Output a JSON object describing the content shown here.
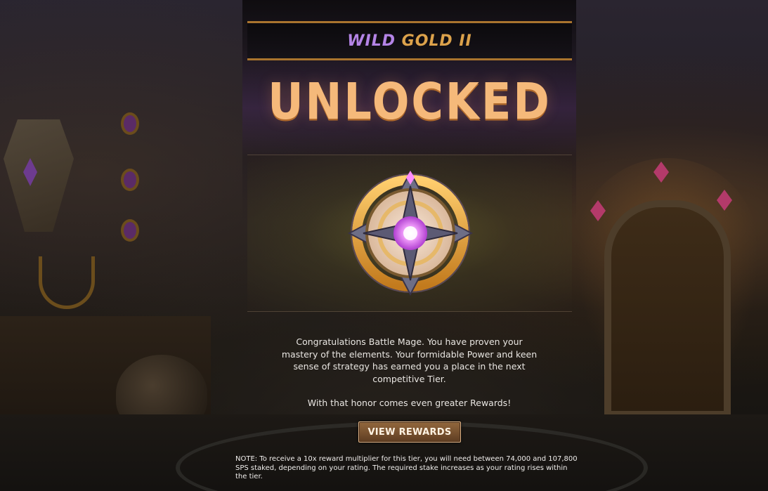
{
  "banner": {
    "tier_word_1": "WILD",
    "tier_word_2": "GOLD II"
  },
  "headline": "UNLOCKED",
  "badge": {
    "icon": "tier-badge-icon"
  },
  "message": {
    "paragraph_1": "Congratulations Battle Mage. You have proven your mastery of the elements. Your formidable Power and keen sense of strategy has earned you a place in the next competitive Tier.",
    "paragraph_2": "With that honor comes even greater Rewards!"
  },
  "button": {
    "label": "VIEW REWARDS"
  },
  "note": "NOTE: To receive a 10x reward multiplier for this tier, you will need between 74,000 and 107,800 SPS staked, depending on your rating. The required stake increases as your rating rises within the tier.",
  "colors": {
    "tier_purple": "#b484e6",
    "tier_gold": "#dca24b",
    "headline": "#f5b97a",
    "button_bg": "#7a5230"
  }
}
